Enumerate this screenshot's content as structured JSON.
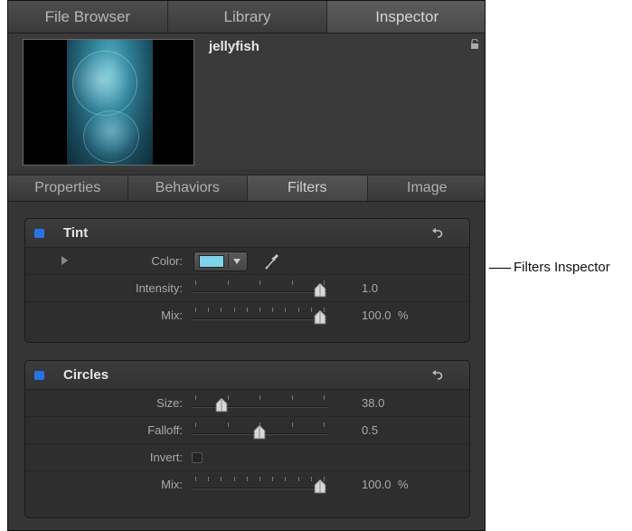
{
  "top_tabs": [
    {
      "label": "File Browser"
    },
    {
      "label": "Library"
    },
    {
      "label": "Inspector"
    }
  ],
  "preview": {
    "clip_name": "jellyfish"
  },
  "sub_tabs": [
    {
      "label": "Properties"
    },
    {
      "label": "Behaviors"
    },
    {
      "label": "Filters"
    },
    {
      "label": "Image"
    }
  ],
  "filters": {
    "tint": {
      "title": "Tint",
      "color_label": "Color:",
      "color_value": "#7fd3ea",
      "intensity_label": "Intensity:",
      "intensity_value": "1.0",
      "intensity_fraction": 1.0,
      "mix_label": "Mix:",
      "mix_value": "100.0",
      "mix_unit": "%",
      "mix_fraction": 1.0
    },
    "circles": {
      "title": "Circles",
      "size_label": "Size:",
      "size_value": "38.0",
      "size_fraction": 0.19,
      "falloff_label": "Falloff:",
      "falloff_value": "0.5",
      "falloff_fraction": 0.5,
      "invert_label": "Invert:",
      "mix_label": "Mix:",
      "mix_value": "100.0",
      "mix_unit": "%",
      "mix_fraction": 1.0
    }
  },
  "callout": {
    "label": "Filters Inspector"
  },
  "colors": {
    "enable_checkbox": "#2a73e6",
    "panel_bg": "#353535"
  }
}
